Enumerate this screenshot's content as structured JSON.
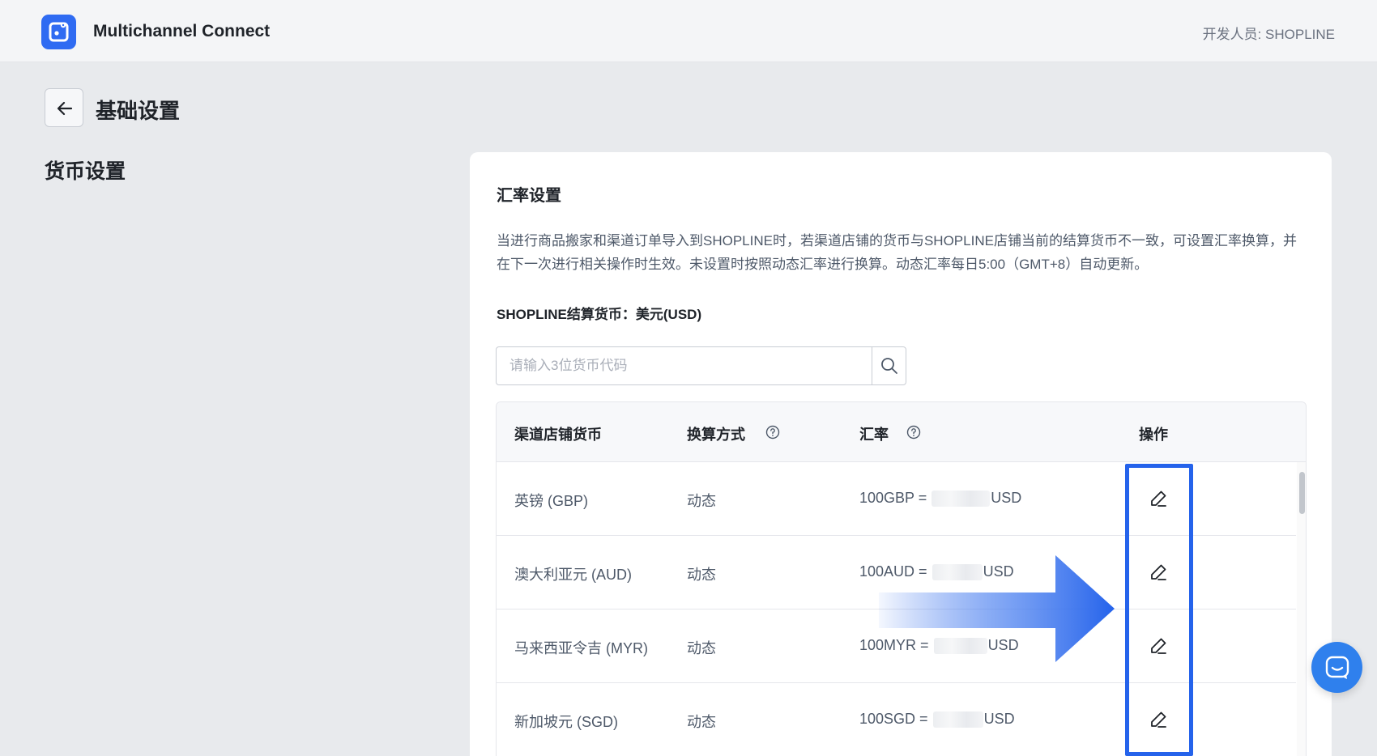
{
  "header": {
    "app_title": "Multichannel Connect",
    "developer": "开发人员: SHOPLINE"
  },
  "page": {
    "title": "基础设置",
    "section_title": "货币设置"
  },
  "card": {
    "title": "汇率设置",
    "description": "当进行商品搬家和渠道订单导入到SHOPLINE时，若渠道店铺的货币与SHOPLINE店铺当前的结算货币不一致，可设置汇率换算，并在下一次进行相关操作时生效。未设置时按照动态汇率进行换算。动态汇率每日5:00（GMT+8）自动更新。",
    "settlement": "SHOPLINE结算货币：美元(USD)",
    "search_placeholder": "请输入3位货币代码"
  },
  "table": {
    "headers": {
      "currency": "渠道店铺货币",
      "method": "换算方式",
      "rate": "汇率",
      "action": "操作"
    },
    "rows": [
      {
        "currency": "英镑 (GBP)",
        "method": "动态",
        "rate_prefix": "100GBP =",
        "rate_suffix": "USD"
      },
      {
        "currency": "澳大利亚元 (AUD)",
        "method": "动态",
        "rate_prefix": "100AUD =",
        "rate_suffix": "USD"
      },
      {
        "currency": "马来西亚令吉 (MYR)",
        "method": "动态",
        "rate_prefix": "100MYR =",
        "rate_suffix": "USD"
      },
      {
        "currency": "新加坡元 (SGD)",
        "method": "动态",
        "rate_prefix": "100SGD =",
        "rate_suffix": "USD"
      }
    ]
  },
  "colors": {
    "brand": "#2f6bf2",
    "highlight": "#2563eb",
    "background": "#e8eaed"
  },
  "icons": {
    "logo": "app-logo-icon",
    "back": "arrow-left-icon",
    "search": "search-icon",
    "help": "question-circle-icon",
    "edit": "edit-pencil-icon",
    "chat": "chat-icon"
  }
}
